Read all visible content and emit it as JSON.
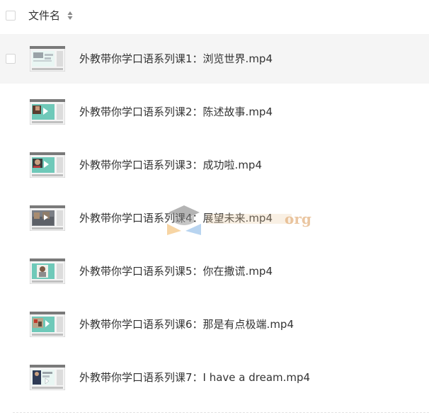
{
  "header": {
    "column_label": "文件名"
  },
  "files": [
    {
      "name": "外教带你学口语系列课1：浏览世界.mp4",
      "selected": true
    },
    {
      "name": "外教带你学口语系列课2：陈述故事.mp4",
      "selected": false
    },
    {
      "name": "外教带你学口语系列课3：成功啦.mp4",
      "selected": false
    },
    {
      "name": "外教带你学口语系列课4：展望未来.mp4",
      "selected": false
    },
    {
      "name": "外教带你学口语系列课5：你在撒谎.mp4",
      "selected": false
    },
    {
      "name": "外教带你学口语系列课6：那是有点极端.mp4",
      "selected": false
    },
    {
      "name": "外教带你学口语系列课7：I have a dream.mp4",
      "selected": false
    }
  ],
  "watermark": {
    "text": "org"
  },
  "colors": {
    "row_hover_bg": "#f5f5f5",
    "text": "#333333",
    "checkbox_border": "#d6d6d6",
    "thumb_teal": "#6fc9b9"
  }
}
